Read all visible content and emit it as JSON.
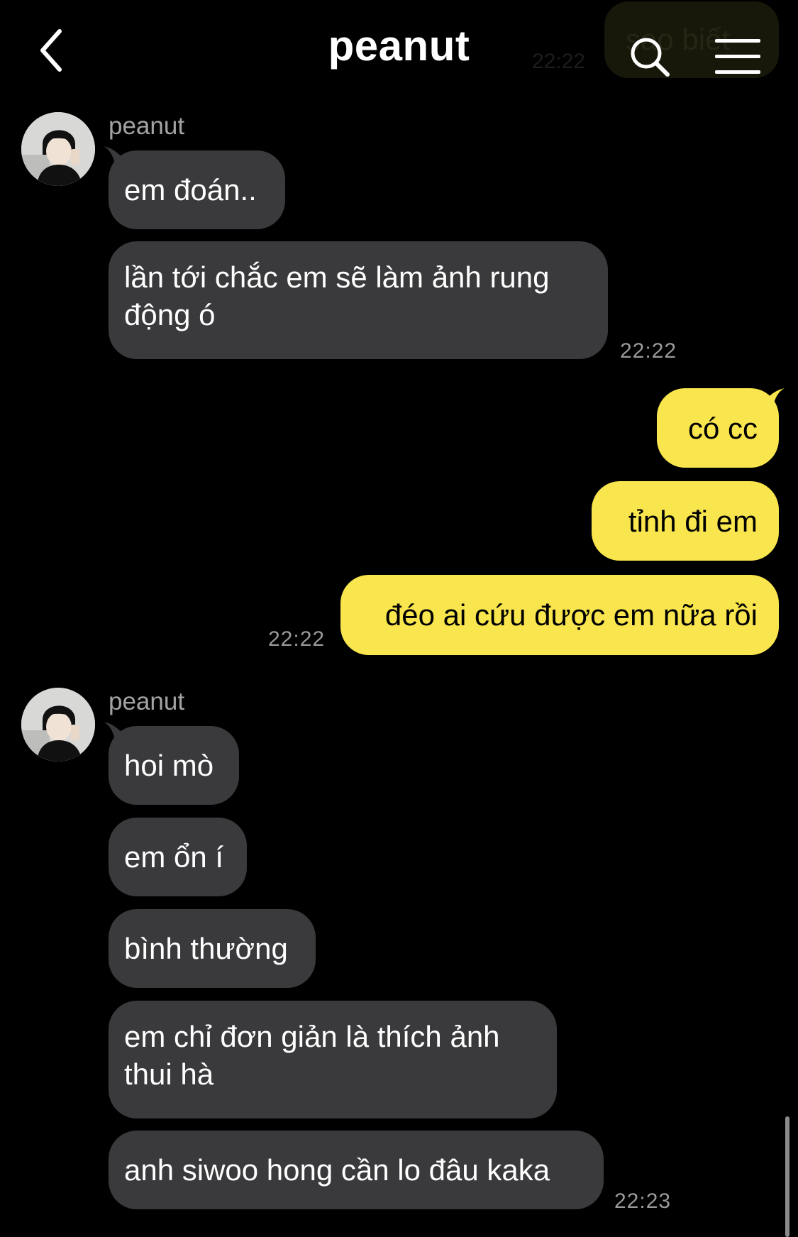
{
  "header": {
    "title": "peanut",
    "back_icon": "chevron-left-icon",
    "search_icon": "search-icon",
    "menu_icon": "hamburger-menu-icon"
  },
  "ghost": {
    "text": "sao biết",
    "time": "22:22"
  },
  "colors": {
    "background": "#000000",
    "incoming_bubble": "#3a3a3c",
    "outgoing_bubble": "#f9e54d",
    "timestamp": "#9a9a9a"
  },
  "groups": [
    {
      "sender": "peanut",
      "messages": [
        {
          "text": "em đoán.."
        },
        {
          "text": "lần tới chắc em sẽ làm ảnh rung động ó"
        }
      ],
      "time": "22:22"
    },
    {
      "sender": "me",
      "messages": [
        {
          "text": "có cc"
        },
        {
          "text": "tỉnh đi em"
        },
        {
          "text": "đéo ai cứu được em nữa rồi"
        }
      ],
      "time": "22:22"
    },
    {
      "sender": "peanut",
      "messages": [
        {
          "text": "hoi mò"
        },
        {
          "text": "em ổn í"
        },
        {
          "text": "bình thường"
        },
        {
          "text": "em chỉ đơn giản là thích ảnh thui hà"
        },
        {
          "text": "anh siwoo hong cần lo đâu kaka"
        }
      ],
      "time": "22:23"
    }
  ]
}
